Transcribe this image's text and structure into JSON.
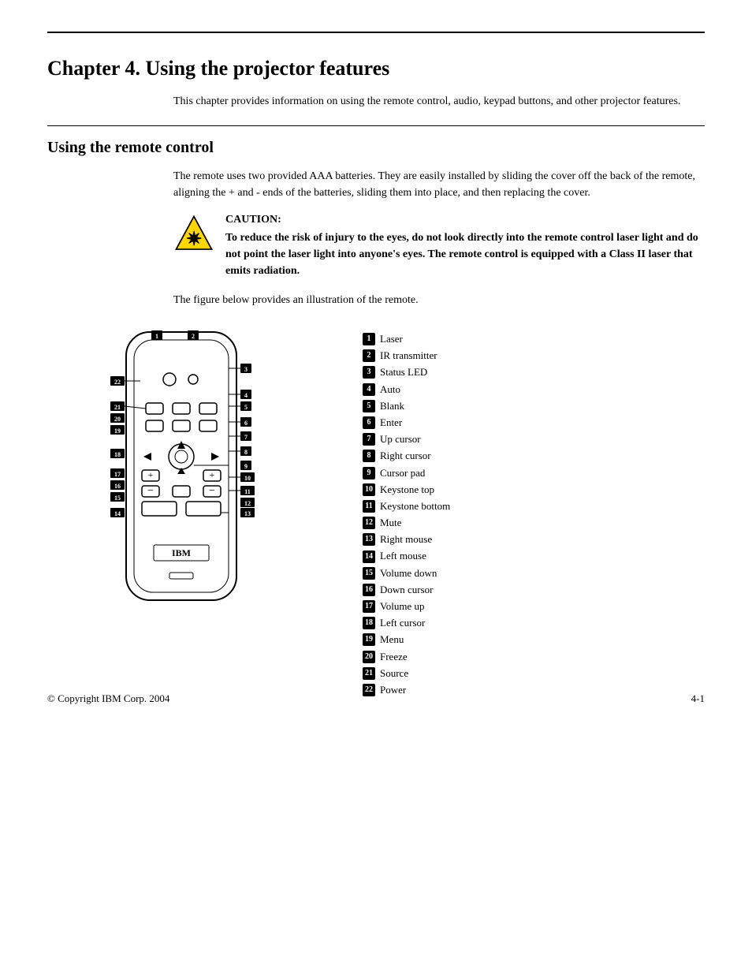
{
  "page": {
    "chapter_title": "Chapter 4. Using the projector features",
    "intro_text": "This chapter provides information on using the remote control, audio, keypad buttons, and other projector features.",
    "section_title": "Using the remote control",
    "remote_text": "The remote uses two provided AAA batteries. They are easily installed by sliding the cover off the back of the remote, aligning the + and - ends of the batteries, sliding them into place, and then replacing the cover.",
    "caution_label": "CAUTION:",
    "caution_body": "To reduce the risk of injury to the eyes, do not look directly into the remote control laser light and do not point the laser light into anyone's eyes. The remote control is equipped with a Class II laser that emits radiation.",
    "figure_text": "The figure below provides an illustration of the remote.",
    "legend": [
      {
        "num": "1",
        "label": "Laser"
      },
      {
        "num": "2",
        "label": "IR transmitter"
      },
      {
        "num": "3",
        "label": "Status LED"
      },
      {
        "num": "4",
        "label": "Auto"
      },
      {
        "num": "5",
        "label": "Blank"
      },
      {
        "num": "6",
        "label": "Enter"
      },
      {
        "num": "7",
        "label": "Up cursor"
      },
      {
        "num": "8",
        "label": "Right cursor"
      },
      {
        "num": "9",
        "label": "Cursor pad"
      },
      {
        "num": "10",
        "label": "Keystone top"
      },
      {
        "num": "11",
        "label": "Keystone bottom"
      },
      {
        "num": "12",
        "label": "Mute"
      },
      {
        "num": "13",
        "label": "Right mouse"
      },
      {
        "num": "14",
        "label": "Left mouse"
      },
      {
        "num": "15",
        "label": "Volume down"
      },
      {
        "num": "16",
        "label": "Down cursor"
      },
      {
        "num": "17",
        "label": "Volume up"
      },
      {
        "num": "18",
        "label": "Left cursor"
      },
      {
        "num": "19",
        "label": "Menu"
      },
      {
        "num": "20",
        "label": "Freeze"
      },
      {
        "num": "21",
        "label": "Source"
      },
      {
        "num": "22",
        "label": "Power"
      }
    ],
    "footer_copyright": "© Copyright IBM Corp. 2004",
    "footer_page": "4-1"
  }
}
